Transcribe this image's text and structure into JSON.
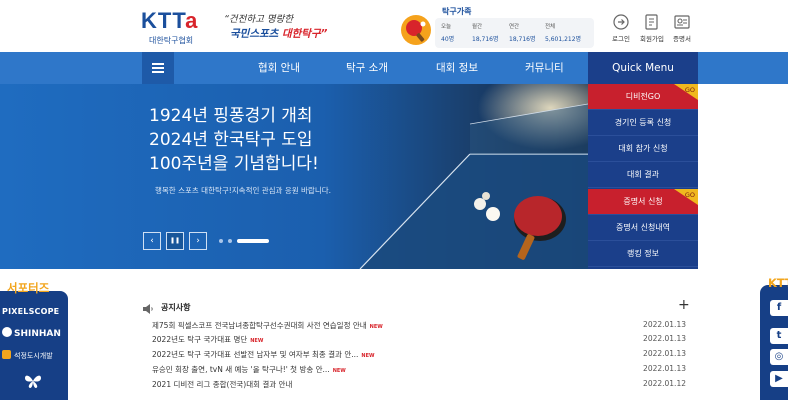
{
  "header": {
    "logo_mark": "KTTA",
    "logo_name": "대한탁구협회",
    "slogan_line1": "“건전하고 명랑한",
    "slogan_line2a": "국민스포츠",
    "slogan_line2b": "대한탁구”",
    "family_title": "탁구가족",
    "stats": [
      {
        "label": "오늘",
        "value": "40명"
      },
      {
        "label": "월간",
        "value": "18,716명"
      },
      {
        "label": "연간",
        "value": "18,716명"
      },
      {
        "label": "전체",
        "value": "5,601,212명"
      }
    ],
    "util": [
      {
        "label": "로그인",
        "icon": "login-icon"
      },
      {
        "label": "회원가입",
        "icon": "signup-icon"
      },
      {
        "label": "증명서",
        "icon": "certificate-icon"
      }
    ]
  },
  "nav": {
    "items": [
      "협회 안내",
      "탁구 소개",
      "대회 정보",
      "커뮤니티"
    ],
    "quick_menu": "Quick Menu"
  },
  "hero": {
    "line1": "1924년 핑퐁경기 개최",
    "line2": "2024년 한국탁구 도입",
    "line3": "100주년을 기념합니다!",
    "sub": "행복한 스포츠 대한탁구!지속적인 관심과 응원 바랍니다.",
    "prev": "‹",
    "pause": "❚❚",
    "next": "›"
  },
  "quick": {
    "items": [
      {
        "label": "디비전GO",
        "go": "GO"
      },
      {
        "label": "경기인 등록 신청"
      },
      {
        "label": "대회 참가 신청"
      },
      {
        "label": "대회 결과"
      },
      {
        "label": "증명서 신청",
        "go": "GO"
      },
      {
        "label": "증명서 신청내역"
      },
      {
        "label": "랭킹 정보"
      }
    ]
  },
  "supporters": {
    "title": "서포터즈",
    "logos": [
      "PIXELSCOPE",
      "SHINHAN",
      "석정도시개발"
    ]
  },
  "notice": {
    "title": "공지사항",
    "more": "+",
    "rows": [
      {
        "text": "제75회 픽셀스코프 전국남녀종합탁구선수권대회 사전 연습일정 안내",
        "new": "NEW",
        "date": "2022.01.13"
      },
      {
        "text": "2022년도 탁구 국가대표 명단",
        "new": "NEW",
        "date": "2022.01.13"
      },
      {
        "text": "2022년도 탁구 국가대표 선발전 남자부 및 여자부 최종 결과 안...",
        "new": "NEW",
        "date": "2022.01.13"
      },
      {
        "text": "유승민 회장 출연, tvN 새 예능 '올 탁구나!' 첫 방송 안...",
        "new": "NEW",
        "date": "2022.01.13"
      },
      {
        "text": "2021 디비전 리그 종합(전국)대회 결과 안내",
        "new": "",
        "date": "2022.01.12"
      }
    ]
  },
  "sns": {
    "title": "KTT",
    "icons": [
      {
        "glyph": "f",
        "icon": "facebook-icon"
      },
      {
        "glyph": "t",
        "icon": "twitter-icon"
      },
      {
        "glyph": "◎",
        "icon": "instagram-icon"
      },
      {
        "glyph": "▶",
        "icon": "youtube-icon"
      }
    ]
  }
}
